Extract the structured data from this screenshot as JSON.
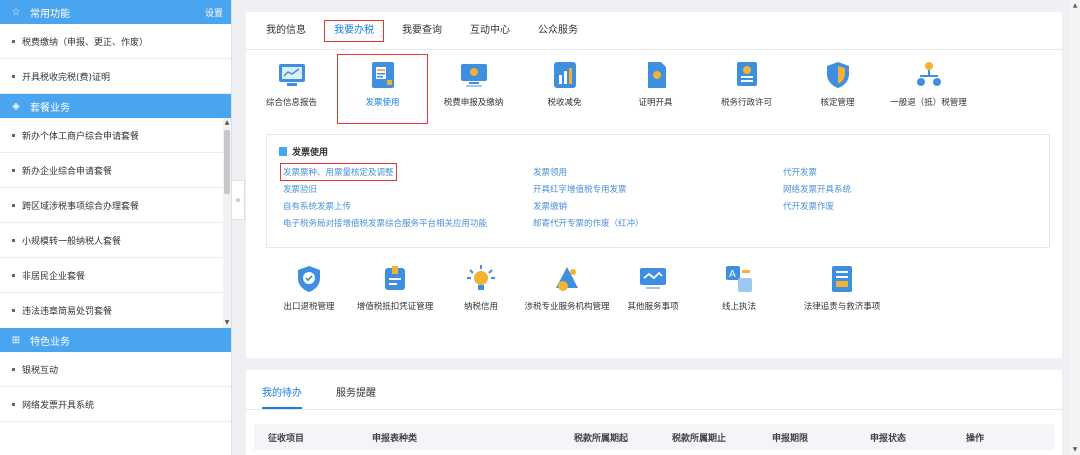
{
  "sidebar": {
    "common": {
      "title": "常用功能",
      "setting": "设置",
      "items": [
        "税费缴纳（申报、更正、作废）",
        "开具税收完税(费)证明"
      ]
    },
    "package": {
      "title": "套餐业务",
      "items": [
        "新办个体工商户综合申请套餐",
        "新办企业综合申请套餐",
        "跨区域涉税事项综合办理套餐",
        "小规模转一般纳税人套餐",
        "非居民企业套餐",
        "违法违章简易处罚套餐"
      ]
    },
    "feature": {
      "title": "特色业务",
      "items": [
        "银税互动",
        "网络发票开具系统"
      ]
    }
  },
  "tabs": [
    "我的信息",
    "我要办税",
    "我要查询",
    "互动中心",
    "公众服务"
  ],
  "functions": [
    "综合信息报告",
    "发票使用",
    "税费申报及缴纳",
    "税收减免",
    "证明开具",
    "税务行政许可",
    "核定管理",
    "一般退（抵）税管理"
  ],
  "invoice_panel": {
    "title": "发票使用",
    "col1": [
      "发票票种、用票量核定及调整",
      "发票验旧",
      "自有系统发票上传",
      "电子税务局对接增值税发票综合服务平台相关应用功能"
    ],
    "col2": [
      "发票领用",
      "开具红字增值税专用发票",
      "发票缴销",
      "邮寄代开专票的作废（红冲）"
    ],
    "col3": [
      "代开发票",
      "网络发票开具系统",
      "代开发票作废"
    ]
  },
  "functions2": [
    "出口退税管理",
    "增值税抵扣凭证管理",
    "纳税信用",
    "涉税专业服务机构管理",
    "其他服务事项",
    "线上执法",
    "法律追责与救济事项"
  ],
  "bottom": {
    "tabs": [
      "我的待办",
      "服务提醒"
    ],
    "columns": [
      "征收项目",
      "申报表种类",
      "税款所属期起",
      "税款所属期止",
      "申报期限",
      "申报状态",
      "操作"
    ]
  }
}
